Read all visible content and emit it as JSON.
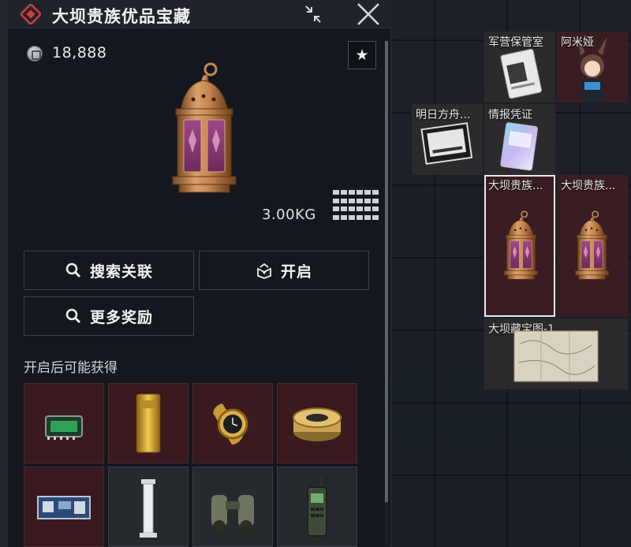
{
  "panel": {
    "title": "大坝贵族优品宝藏",
    "price": "18,888",
    "weight": "3.00KG",
    "item_size_grid": {
      "cols": 6,
      "rows": 4
    }
  },
  "actions": {
    "search_label": "搜索关联",
    "open_label": "开启",
    "more_rewards_label": "更多奖励"
  },
  "rewards_section": {
    "label": "开启后可能获得",
    "items": [
      {
        "icon": "memory-card-icon",
        "rarity": "red"
      },
      {
        "icon": "gold-bar-icon",
        "rarity": "red"
      },
      {
        "icon": "gold-watch-icon",
        "rarity": "red"
      },
      {
        "icon": "caviar-tin-icon",
        "rarity": "red"
      },
      {
        "icon": "circuit-board-icon",
        "rarity": "red"
      },
      {
        "icon": "marble-pillar-icon",
        "rarity": "dark"
      },
      {
        "icon": "binoculars-icon",
        "rarity": "dark"
      },
      {
        "icon": "radio-icon",
        "rarity": "dark"
      }
    ]
  },
  "inventory": {
    "cells": [
      {
        "label": "军营保管室"
      },
      {
        "label": "阿米娅"
      },
      {
        "label": "明日方舟..."
      },
      {
        "label": "情报凭证"
      },
      {
        "label": "大坝贵族..."
      },
      {
        "label": "大坝贵族..."
      },
      {
        "label": "大坝藏宝图-1"
      }
    ]
  },
  "colors": {
    "accent_red": "#d43b3f",
    "rarity_red": "#3a1a1f",
    "panel_bg": "#14181e"
  }
}
